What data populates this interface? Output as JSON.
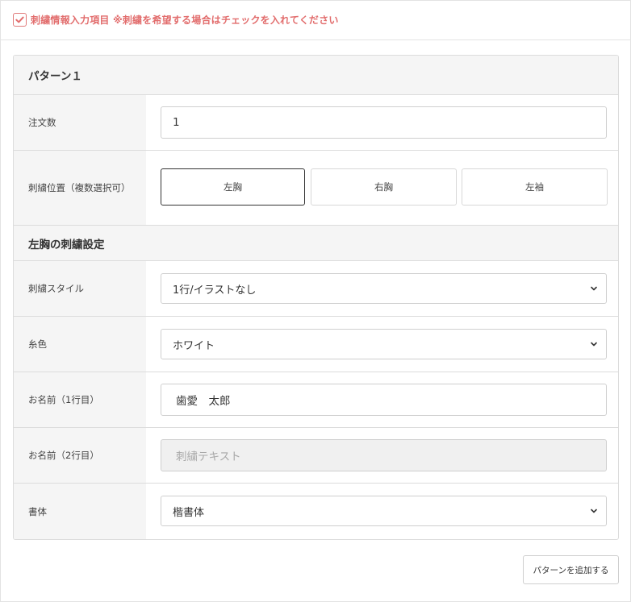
{
  "header": {
    "checked": true,
    "text": "刺繍情報入力項目 ※刺繍を希望する場合はチェックを入れてください",
    "accent_color": "#e26d6d"
  },
  "pattern": {
    "title": "パターン１",
    "order_count": {
      "label": "注文数",
      "value": "1"
    },
    "position": {
      "label": "刺繍位置（複数選択可）",
      "options": [
        "左胸",
        "右胸",
        "左袖"
      ],
      "selected": "左胸"
    },
    "settings": {
      "title": "左胸の刺繍設定",
      "style": {
        "label": "刺繍スタイル",
        "value": "1行/イラストなし"
      },
      "thread_color": {
        "label": "糸色",
        "value": "ホワイト"
      },
      "name_line1": {
        "label": "お名前（1行目）",
        "value": "歯愛　太郎"
      },
      "name_line2": {
        "label": "お名前（2行目）",
        "placeholder": "刺繍テキスト"
      },
      "font": {
        "label": "書体",
        "value": "楷書体"
      }
    }
  },
  "add_pattern_label": "パターンを追加する"
}
